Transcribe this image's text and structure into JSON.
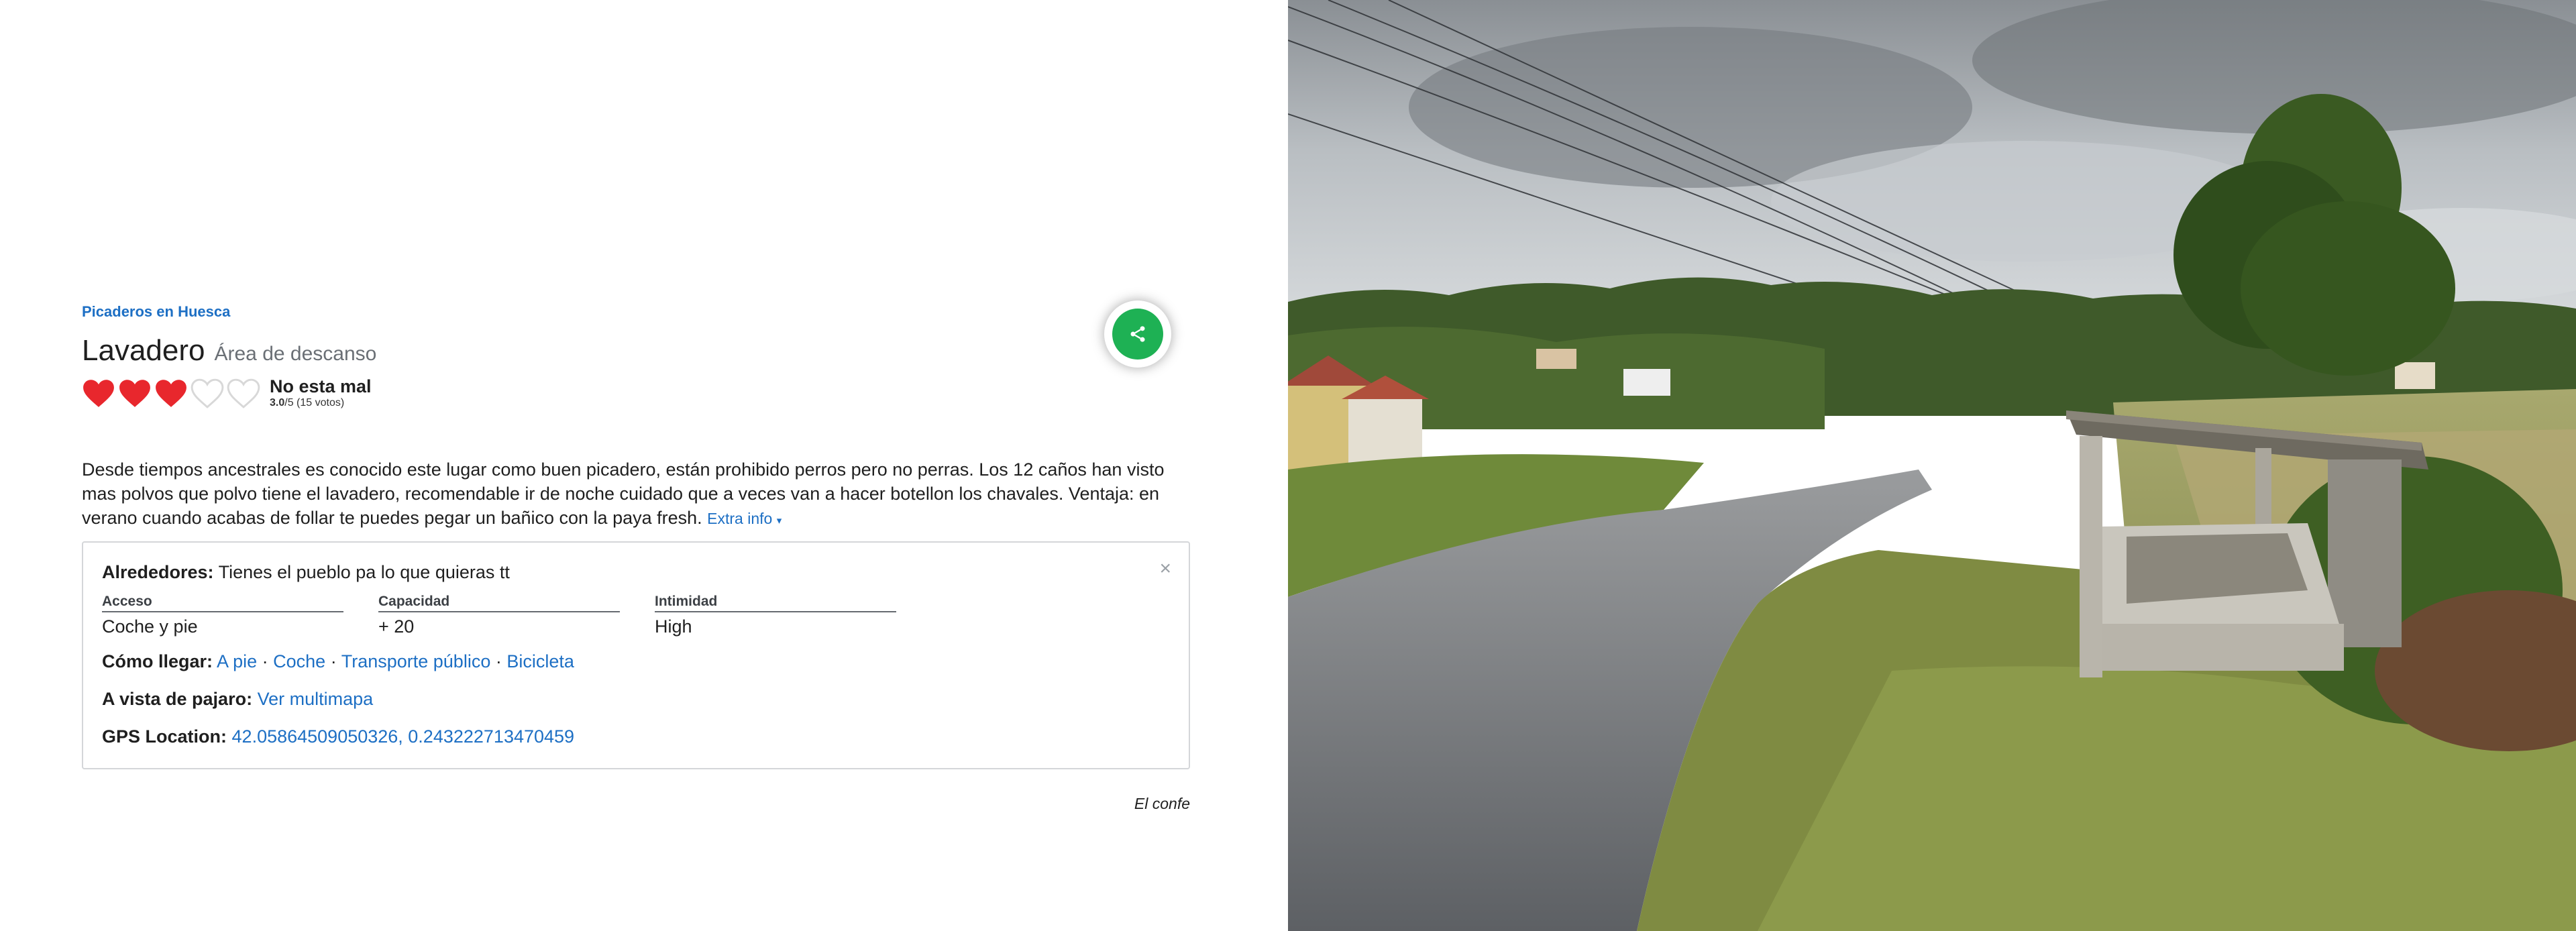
{
  "breadcrumb": "Picaderos en Huesca",
  "place": {
    "name": "Lavadero",
    "category": "Área de descanso"
  },
  "rating": {
    "filled_hearts": 3,
    "total_hearts": 5,
    "label": "No esta mal",
    "score": "3.0",
    "out_of": "/5",
    "votes": "(15 votos)"
  },
  "description": "Desde tiempos ancestrales es conocido este lugar como buen picadero, están prohibido perros pero no perras. Los 12 caños han visto mas polvos que polvo tiene el lavadero, recomendable ir de noche cuidado que a veces van a hacer botellon los chavales. Ventaja: en verano cuando acabas de follar te puedes pegar un bañico con la paya fresh.",
  "extra_info": {
    "label": "Extra info",
    "caret": "▾",
    "close": "×",
    "surroundings_label": "Alrededores:",
    "surroundings_value": "Tienes el pueblo pa lo que quieras tt",
    "stats": [
      {
        "label": "Acceso",
        "value": "Coche y pie"
      },
      {
        "label": "Capacidad",
        "value": "+ 20"
      },
      {
        "label": "Intimidad",
        "value": "High"
      }
    ],
    "how_to_get_label": "Cómo llegar:",
    "how_to_get_options": [
      "A pie",
      "Coche",
      "Transporte público",
      "Bicicleta"
    ],
    "separator": "·",
    "birds_eye_label": "A vista de pajaro:",
    "birds_eye_link": "Ver multimapa",
    "gps_label": "GPS Location:",
    "gps_value": "42.05864509050326, 0.243222713470459"
  },
  "author": "El confe",
  "colors": {
    "accent_blue": "#1d6fc4",
    "heart_red": "#e8272d",
    "share_green": "#1eb154"
  },
  "icons": {
    "share": "share-icon",
    "heart": "heart-icon",
    "close": "close-icon"
  }
}
